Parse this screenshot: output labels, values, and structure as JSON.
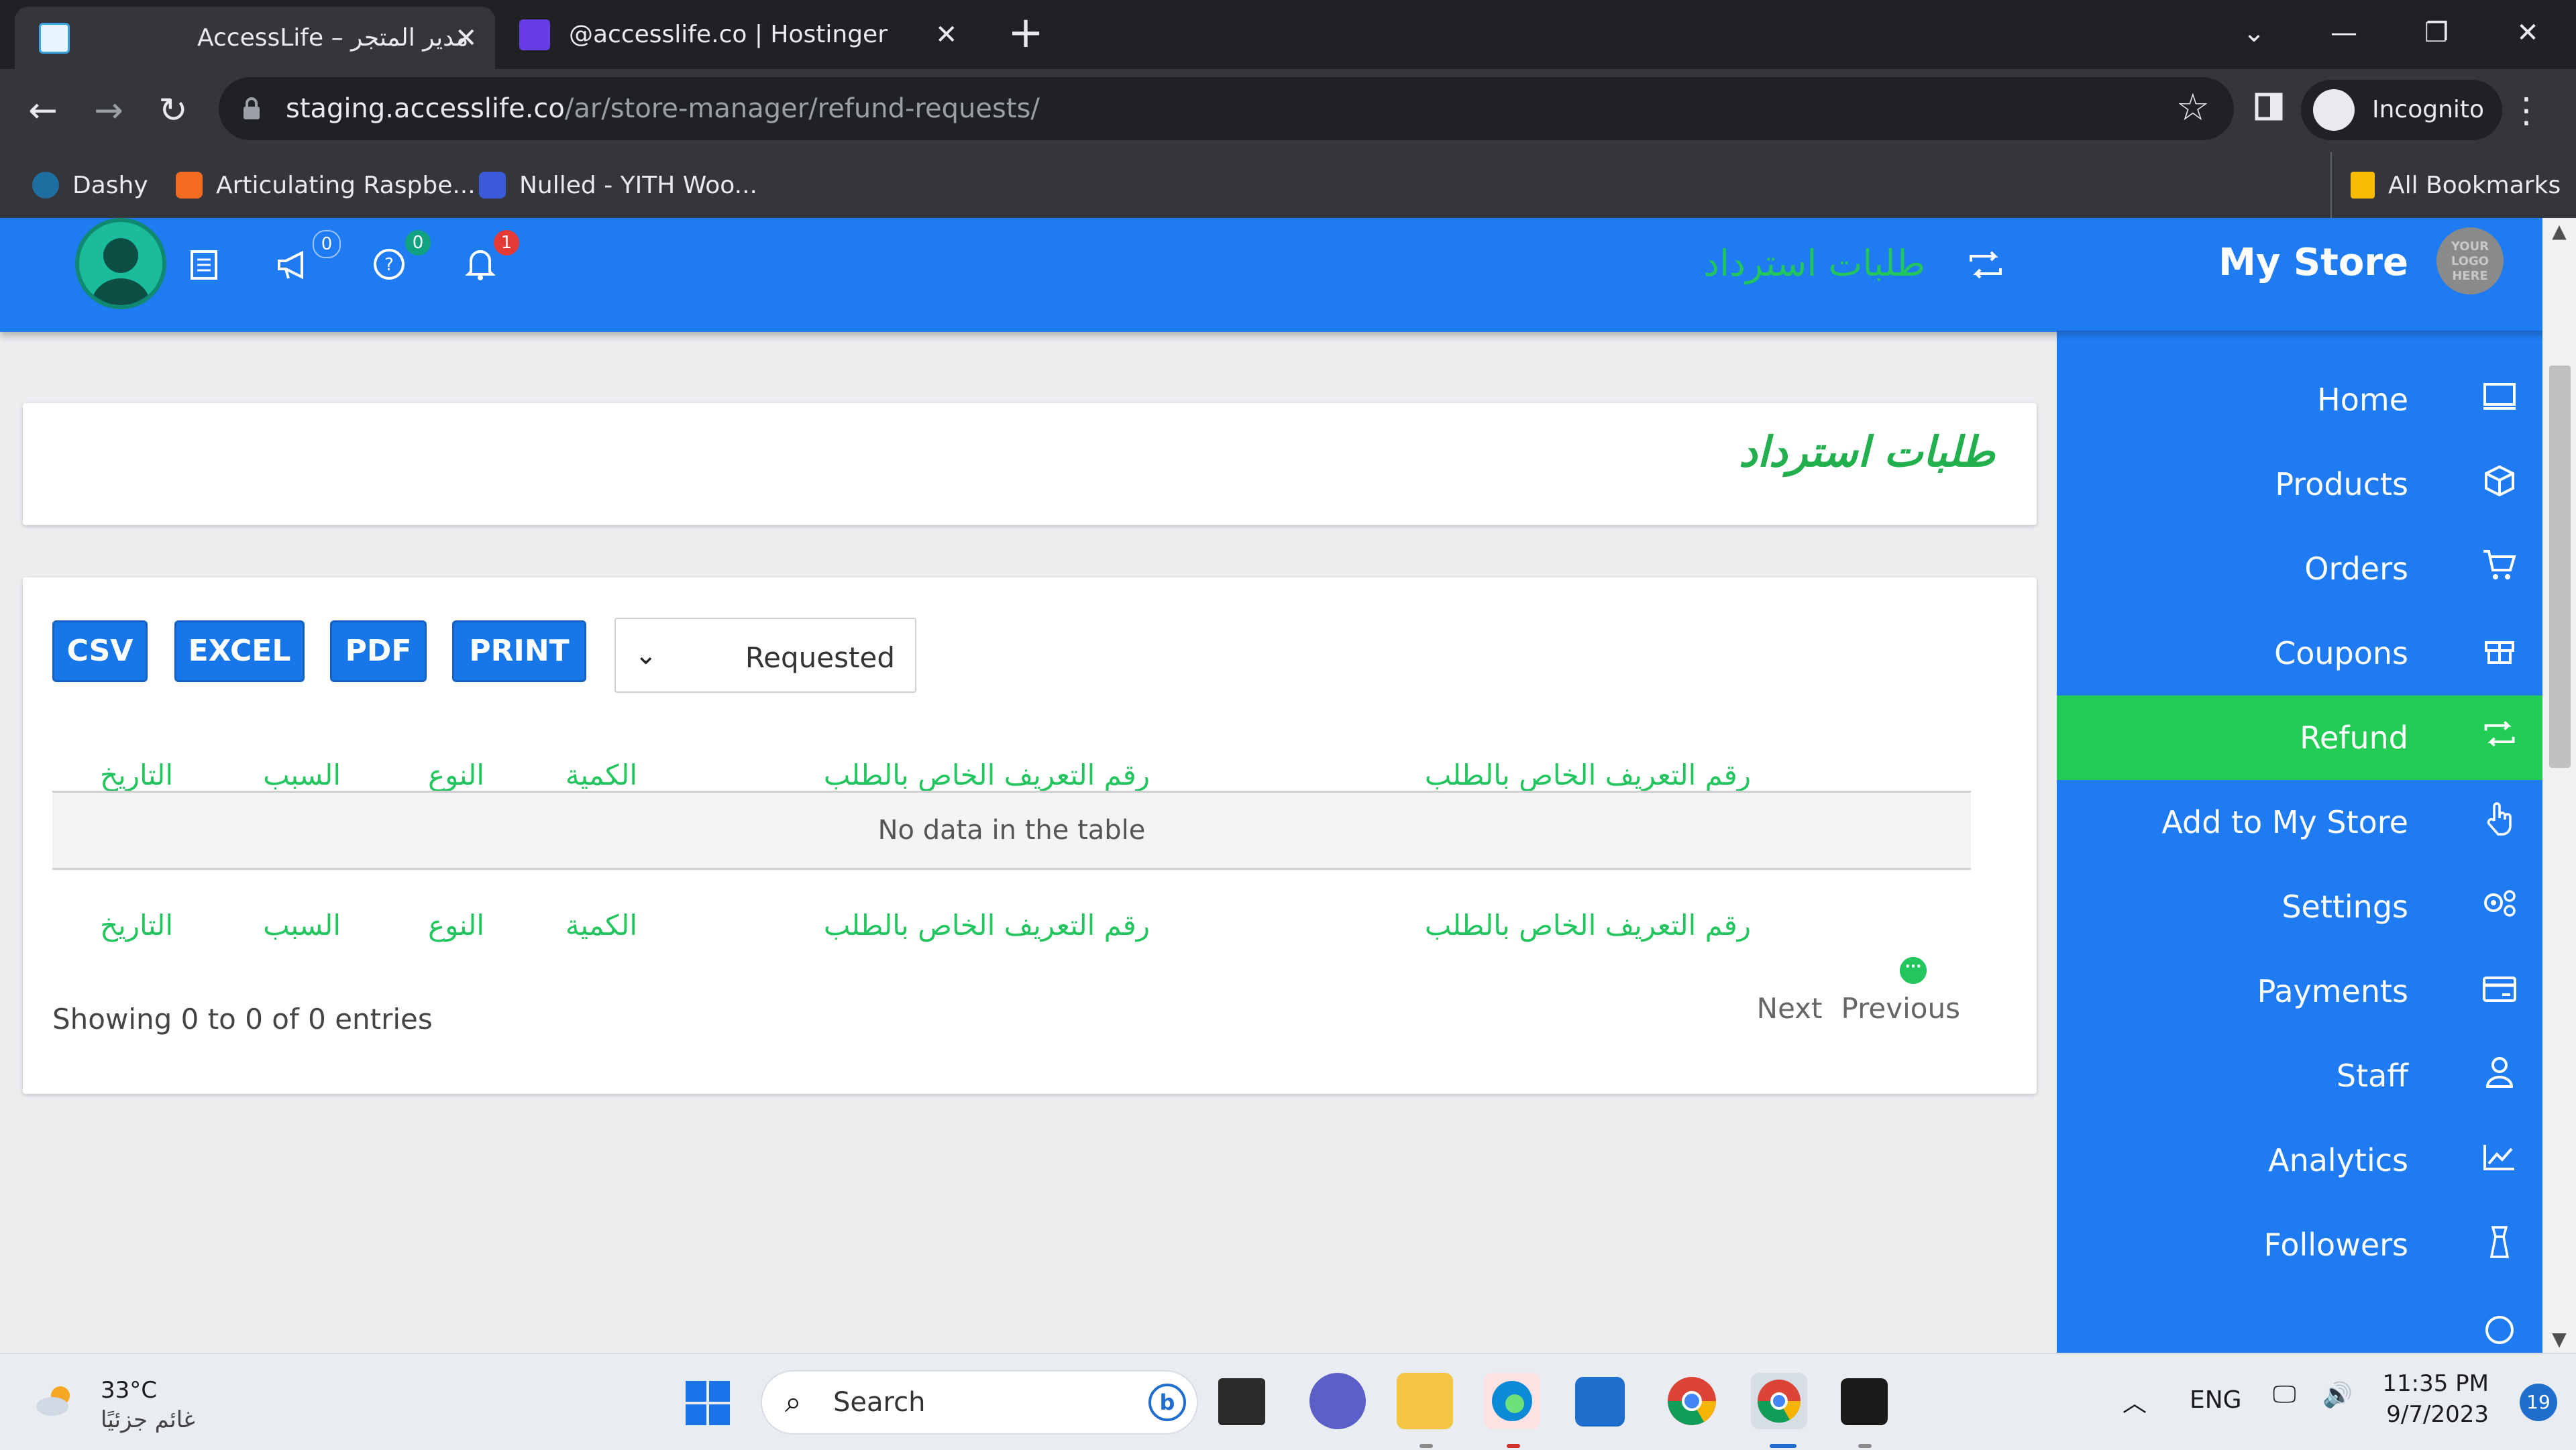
{
  "browser": {
    "tabs": [
      {
        "title": "AccessLife – مدير المتجر",
        "close": "✕"
      },
      {
        "title": "@accesslife.co | Hostinger",
        "close": "✕"
      }
    ],
    "new_tab": "+",
    "window": {
      "minimize": "—",
      "restore": "❐",
      "close": "✕",
      "tab_search": "⌄"
    },
    "nav": {
      "back": "←",
      "forward": "→",
      "reload": "↻"
    },
    "url_host": "staging.accesslife.co",
    "url_path": "/ar/store-manager/refund-requests/",
    "star": "☆",
    "profile_label": "Incognito",
    "menu": "⋮",
    "bookmarks": [
      {
        "label": "Dashy"
      },
      {
        "label": "Articulating Raspbe..."
      },
      {
        "label": "Nulled - YITH Woo..."
      }
    ],
    "all_bookmarks": "All Bookmarks"
  },
  "header": {
    "page_heading": "طلبات استرداد",
    "store_title": "My Store",
    "logo_text": "YOUR LOGO HERE",
    "badges": {
      "announcements": "0",
      "help": "0",
      "notifications": "1"
    }
  },
  "sidebar": {
    "items": [
      {
        "label": "Home",
        "icon": "▭"
      },
      {
        "label": "Products",
        "icon": "⬡"
      },
      {
        "label": "Orders",
        "icon": "🛒"
      },
      {
        "label": "Coupons",
        "icon": "🎁"
      },
      {
        "label": "Refund",
        "icon": "⇄"
      },
      {
        "label": "Add to My Store",
        "icon": "☝"
      },
      {
        "label": "Settings",
        "icon": "⚙"
      },
      {
        "label": "Payments",
        "icon": "▤"
      },
      {
        "label": "Staff",
        "icon": "👤"
      },
      {
        "label": "Analytics",
        "icon": "📈"
      },
      {
        "label": "Followers",
        "icon": "♙"
      }
    ],
    "active_index": 4
  },
  "main": {
    "title": "طلبات استرداد",
    "export_buttons": [
      "CSV",
      "EXCEL",
      "PDF",
      "PRINT"
    ],
    "filter_selected": "Requested",
    "columns": [
      "رقم التعريف الخاص بالطلب",
      "رقم التعريف الخاص بالطلب",
      "الكمية",
      "النوع",
      "السبب",
      "التاريخ"
    ],
    "empty_message": "No data in the table",
    "showing": "Showing 0 to 0 of 0 entries",
    "pager": {
      "next": "Next",
      "previous": "Previous"
    }
  },
  "taskbar": {
    "weather_temp": "33°C",
    "weather_desc": "غائم جزئيًا",
    "search_label": "Search",
    "lang": "ENG",
    "time": "11:35 PM",
    "date": "9/7/2023",
    "notifications": "19"
  },
  "colors": {
    "brand_blue": "#1f7bf1",
    "active_green": "#22cc55",
    "heading_green": "#22b04e"
  }
}
